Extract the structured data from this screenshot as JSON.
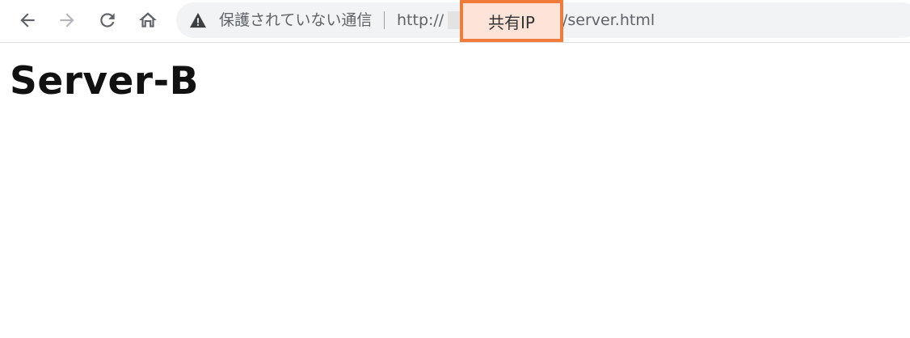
{
  "toolbar": {
    "back_icon": "arrow-left-icon",
    "forward_icon": "arrow-right-icon",
    "reload_icon": "reload-icon",
    "home_icon": "home-icon"
  },
  "omnibox": {
    "security_icon": "warning-icon",
    "security_text": "保護されていない通信",
    "url_scheme": "http://",
    "url_path": "/server.html"
  },
  "annotation": {
    "label": "共有IP",
    "border_color": "#ef7c3d",
    "fill_color": "#fde3d8"
  },
  "page": {
    "heading": "Server-B"
  }
}
